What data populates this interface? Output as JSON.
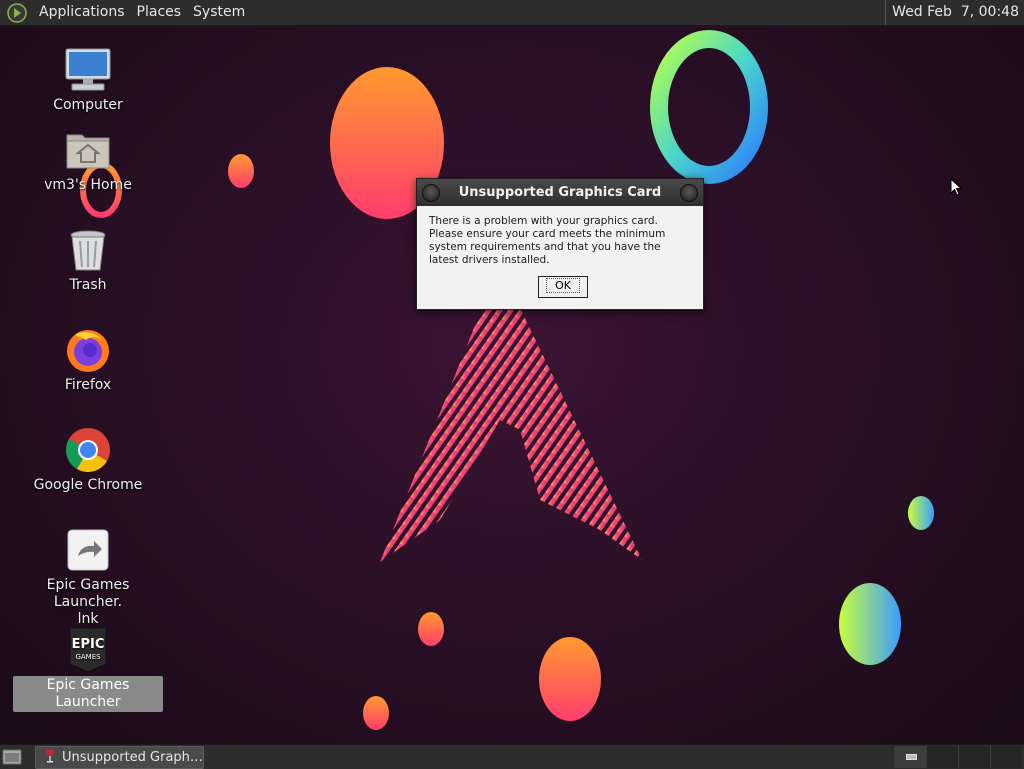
{
  "top_panel": {
    "menus": [
      "Applications",
      "Places",
      "System"
    ],
    "clock": "Wed Feb  7, 00:48"
  },
  "desktop_icons": [
    {
      "label": "Computer",
      "icon": "computer-icon"
    },
    {
      "label": "vm3's Home",
      "icon": "home-folder-icon"
    },
    {
      "label": "Trash",
      "icon": "trash-icon"
    },
    {
      "label": "Firefox",
      "icon": "firefox-icon"
    },
    {
      "label": "Google Chrome",
      "icon": "chrome-icon"
    },
    {
      "label": "Epic Games Launcher.\nlnk",
      "icon": "shortcut-icon"
    },
    {
      "label": "Epic Games Launcher",
      "icon": "epic-games-icon",
      "selected": true
    }
  ],
  "dialog": {
    "title": "Unsupported Graphics Card",
    "message": "There is a problem with your graphics card. Please ensure your card meets the minimum system requirements and that you have the latest drivers installed.",
    "ok_label": "OK"
  },
  "taskbar": {
    "window_button_label": "Unsupported Graph…",
    "workspaces": 4
  },
  "colors": {
    "panel": "#2d2d2d",
    "wallpaper": "#2a0f27",
    "dialog_bg": "#f2f2f2",
    "accent_pink": "#e8347a",
    "accent_orange": "#ff8a3c"
  }
}
